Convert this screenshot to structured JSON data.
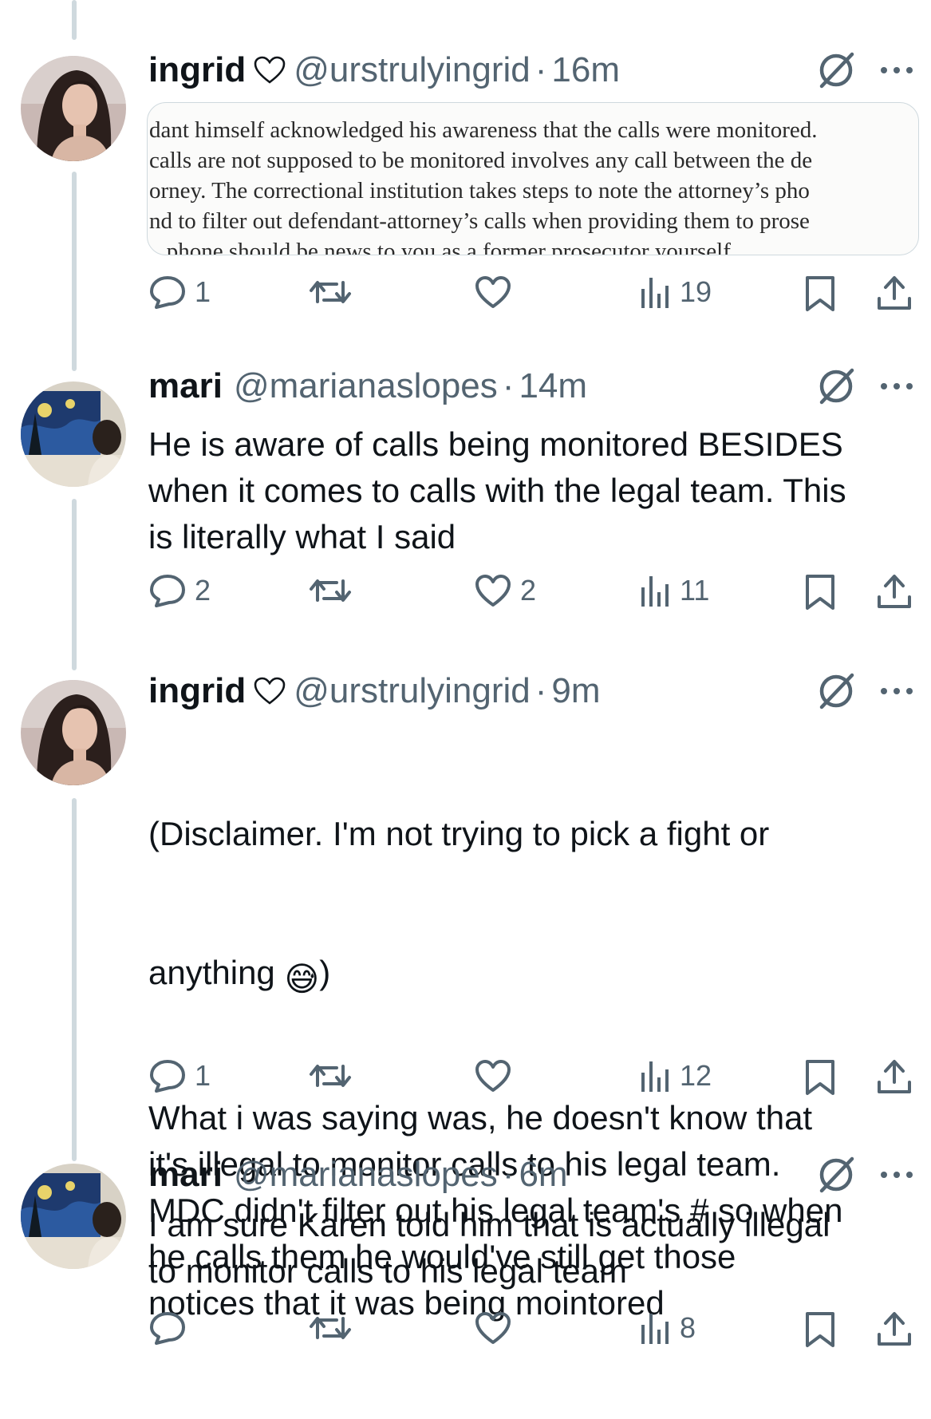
{
  "tweets": [
    {
      "name": "ingrid",
      "handle": "@urstrulyingrid",
      "separator": "·",
      "time": "16m",
      "text": "",
      "quote_lines": [
        "dant himself acknowledged his awareness that the calls were monitored.",
        " calls are not supposed to be monitored involves any call between the de",
        "orney. The correctional institution takes steps to note the attorney’s pho",
        "nd to filter out defendant-attorney’s calls when providing them to prose",
        "...phone should be news to you as a former prosecutor yourself"
      ],
      "replies": "1",
      "reposts": "",
      "likes": "",
      "views": "19"
    },
    {
      "name": "mari",
      "handle": "@marianaslopes",
      "separator": "·",
      "time": "14m",
      "text": "He is aware of calls being monitored BESIDES\nwhen it comes to calls with the legal team. This\nis literally what I said",
      "replies": "2",
      "reposts": "",
      "likes": "2",
      "views": "11"
    },
    {
      "name": "ingrid",
      "handle": "@urstrulyingrid",
      "separator": "·",
      "time": "9m",
      "text_line1": "(Disclaimer. I'm not trying to pick a fight or",
      "text_line2a": "anything ",
      "emoji": "😅",
      "text_line2b": ")",
      "text_rest": "What i was saying was, he doesn't know that\nit's illegal to monitor calls to his legal team.\nMDC didn't filter out his legal team's # so when\nhe calls them he would've still get those\nnotices that it was being mointored",
      "replies": "1",
      "reposts": "",
      "likes": "",
      "views": "12"
    },
    {
      "name": "mari",
      "handle": "@marianaslopes",
      "separator": "·",
      "time": "6m",
      "text": "I am sure Karen told him that is actually illegal\nto monitor calls to his legal team",
      "replies": "",
      "reposts": "",
      "likes": "",
      "views": "8"
    }
  ],
  "icons": {
    "name_heart": "heart-outline-icon",
    "grok": "grok-icon",
    "more": "more-dots-icon",
    "reply": "reply-icon",
    "repost": "repost-icon",
    "like": "like-icon",
    "views": "views-icon",
    "bookmark": "bookmark-icon",
    "share": "share-icon"
  },
  "colors": {
    "text": "#0f1419",
    "secondary": "#536471",
    "thread_line": "#cfd9de"
  }
}
